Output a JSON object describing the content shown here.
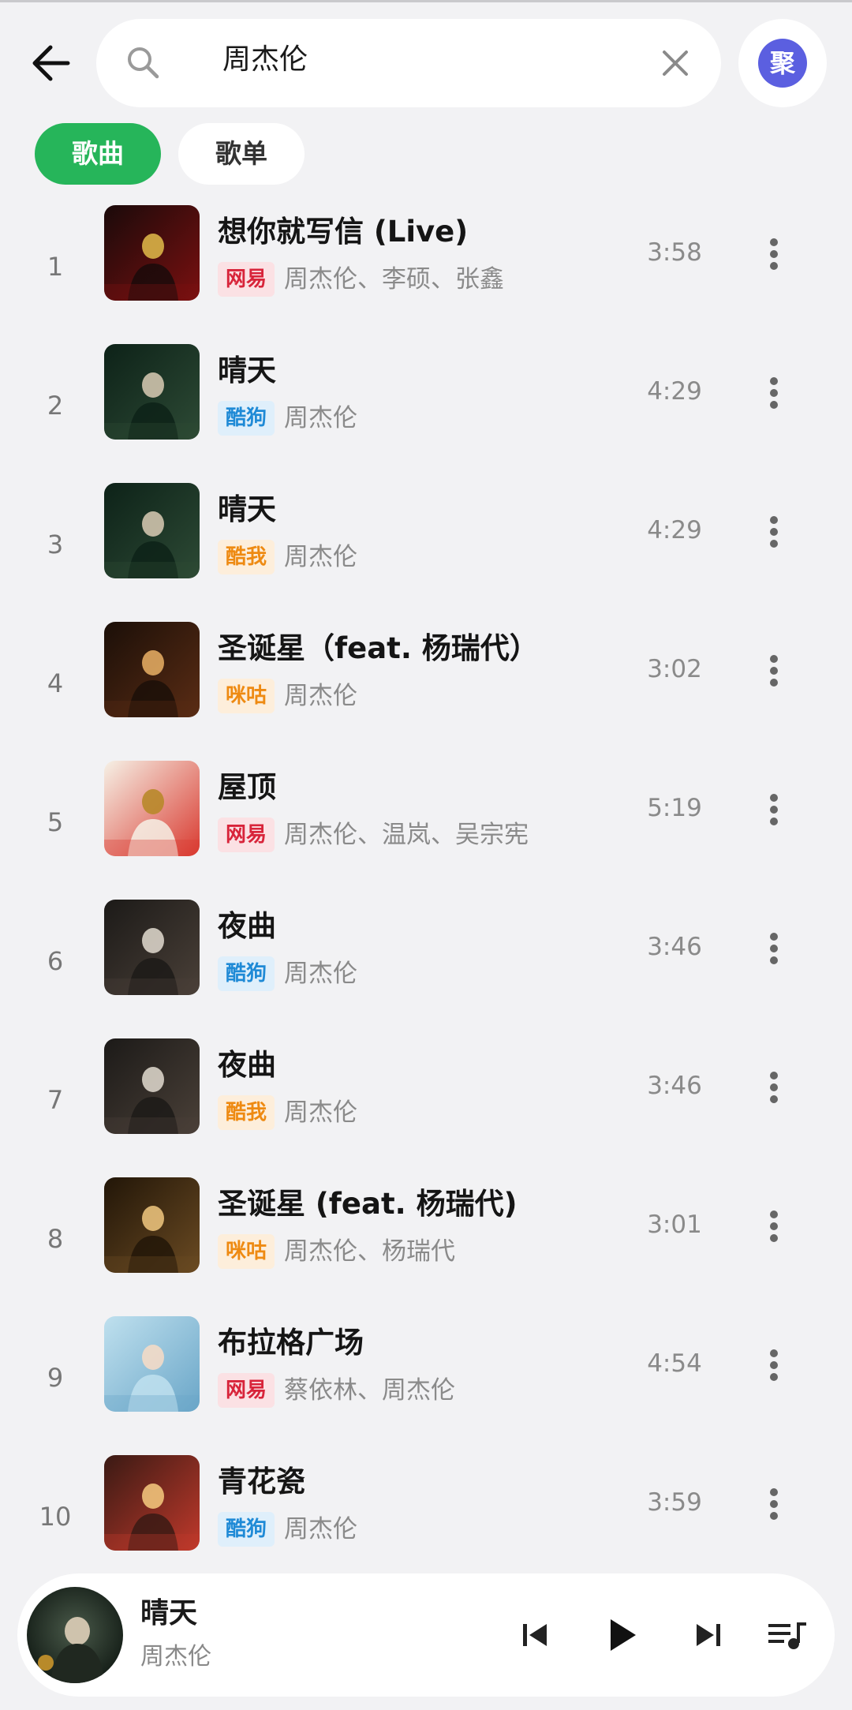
{
  "search": {
    "query": "周杰伦"
  },
  "avatar_label": "聚",
  "tabs": {
    "songs": "歌曲",
    "playlists": "歌单"
  },
  "sources": {
    "netease": {
      "label": "网易",
      "bg": "#fbe1e4",
      "fg": "#d8243a"
    },
    "kugou": {
      "label": "酷狗",
      "bg": "#dfeffb",
      "fg": "#1f8ad6"
    },
    "kuwo": {
      "label": "酷我",
      "bg": "#fdeedb",
      "fg": "#ee8a12"
    },
    "migu": {
      "label": "咪咕",
      "bg": "#fdeedb",
      "fg": "#ee8a12"
    }
  },
  "songs": [
    {
      "index": "1",
      "title": "想你就写信 (Live)",
      "source": "网易",
      "artists": "周杰伦、李硕、张鑫",
      "duration": "3:58"
    },
    {
      "index": "2",
      "title": "晴天",
      "source": "酷狗",
      "artists": "周杰伦",
      "duration": "4:29"
    },
    {
      "index": "3",
      "title": "晴天",
      "source": "酷我",
      "artists": "周杰伦",
      "duration": "4:29"
    },
    {
      "index": "4",
      "title": "圣诞星（feat. 杨瑞代）",
      "source": "咪咕",
      "artists": "周杰伦",
      "duration": "3:02"
    },
    {
      "index": "5",
      "title": "屋顶",
      "source": "网易",
      "artists": "周杰伦、温岚、吴宗宪",
      "duration": "5:19"
    },
    {
      "index": "6",
      "title": "夜曲",
      "source": "酷狗",
      "artists": "周杰伦",
      "duration": "3:46"
    },
    {
      "index": "7",
      "title": "夜曲",
      "source": "酷我",
      "artists": "周杰伦",
      "duration": "3:46"
    },
    {
      "index": "8",
      "title": "圣诞星 (feat. 杨瑞代)",
      "source": "咪咕",
      "artists": "周杰伦、杨瑞代",
      "duration": "3:01"
    },
    {
      "index": "9",
      "title": "布拉格广场",
      "source": "网易",
      "artists": "蔡依林、周杰伦",
      "duration": "4:54"
    },
    {
      "index": "10",
      "title": "青花瓷",
      "source": "酷狗",
      "artists": "周杰伦",
      "duration": "3:59"
    }
  ],
  "now_playing": {
    "title": "晴天",
    "artist": "周杰伦"
  },
  "colors": {
    "accent": "#26b55a",
    "avatar": "#5b5fe0"
  }
}
